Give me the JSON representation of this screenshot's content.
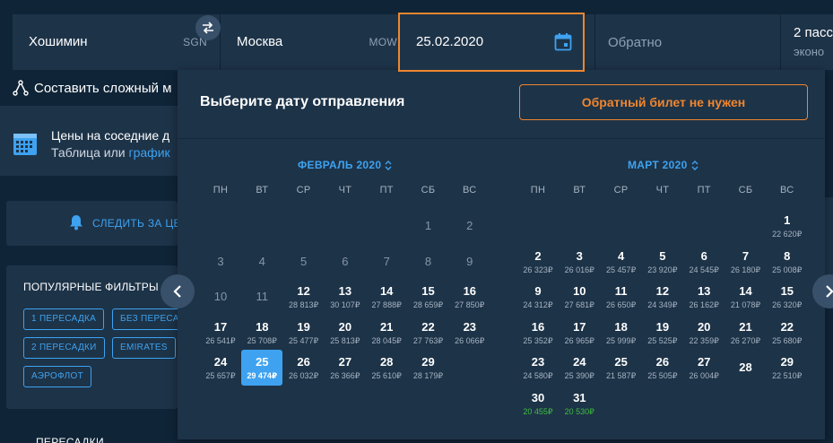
{
  "search": {
    "from_city": "Хошимин",
    "from_code": "SGN",
    "to_city": "Москва",
    "to_code": "MOW",
    "depart_date": "25.02.2020",
    "return_placeholder": "Обратно",
    "passengers": "2 пасс",
    "cabin": "эконо"
  },
  "left": {
    "complex_route": "Составить сложный м",
    "nearby_title": "Цены на соседние д",
    "nearby_table": "Таблица",
    "nearby_or": "или",
    "nearby_chart": "график",
    "follow_label": "СЛЕДИТЬ ЗА ЦЕ",
    "filters_title": "ПОПУЛЯРНЫЕ ФИЛЬТРЫ",
    "chips": [
      "1 ПЕРЕСАДКА",
      "БЕЗ ПЕРЕСАД",
      "2 ПЕРЕСАДКИ",
      "EMIRATES",
      "АЭРОФЛОТ"
    ],
    "transfers_title": "ПЕРЕСАДКИ"
  },
  "calendar": {
    "title": "Выберите дату отправления",
    "no_return_button": "Обратный билет не нужен",
    "weekdays": [
      "ПН",
      "ВТ",
      "СР",
      "ЧТ",
      "ПТ",
      "СБ",
      "ВС"
    ],
    "months": [
      {
        "name": "ФЕВРАЛЬ 2020",
        "days": [
          {
            "d": "1",
            "col": 5,
            "row": 0,
            "past": true
          },
          {
            "d": "2",
            "col": 6,
            "row": 0,
            "past": true
          },
          {
            "d": "3",
            "col": 0,
            "row": 1,
            "past": true
          },
          {
            "d": "4",
            "col": 1,
            "row": 1,
            "past": true
          },
          {
            "d": "5",
            "col": 2,
            "row": 1,
            "past": true
          },
          {
            "d": "6",
            "col": 3,
            "row": 1,
            "past": true
          },
          {
            "d": "7",
            "col": 4,
            "row": 1,
            "past": true
          },
          {
            "d": "8",
            "col": 5,
            "row": 1,
            "past": true
          },
          {
            "d": "9",
            "col": 6,
            "row": 1,
            "past": true
          },
          {
            "d": "10",
            "col": 0,
            "row": 2,
            "past": true
          },
          {
            "d": "11",
            "col": 1,
            "row": 2,
            "past": true
          },
          {
            "d": "12",
            "col": 2,
            "row": 2,
            "p": "28 813₽"
          },
          {
            "d": "13",
            "col": 3,
            "row": 2,
            "p": "30 107₽"
          },
          {
            "d": "14",
            "col": 4,
            "row": 2,
            "p": "27 888₽"
          },
          {
            "d": "15",
            "col": 5,
            "row": 2,
            "p": "28 659₽"
          },
          {
            "d": "16",
            "col": 6,
            "row": 2,
            "p": "27 850₽"
          },
          {
            "d": "17",
            "col": 0,
            "row": 3,
            "p": "26 541₽"
          },
          {
            "d": "18",
            "col": 1,
            "row": 3,
            "p": "25 708₽"
          },
          {
            "d": "19",
            "col": 2,
            "row": 3,
            "p": "25 477₽"
          },
          {
            "d": "20",
            "col": 3,
            "row": 3,
            "p": "25 813₽"
          },
          {
            "d": "21",
            "col": 4,
            "row": 3,
            "p": "28 045₽"
          },
          {
            "d": "22",
            "col": 5,
            "row": 3,
            "p": "27 763₽"
          },
          {
            "d": "23",
            "col": 6,
            "row": 3,
            "p": "26 066₽"
          },
          {
            "d": "24",
            "col": 0,
            "row": 4,
            "p": "25 657₽"
          },
          {
            "d": "25",
            "col": 1,
            "row": 4,
            "p": "29 474₽",
            "sel": true
          },
          {
            "d": "26",
            "col": 2,
            "row": 4,
            "p": "26 032₽"
          },
          {
            "d": "27",
            "col": 3,
            "row": 4,
            "p": "26 366₽"
          },
          {
            "d": "28",
            "col": 4,
            "row": 4,
            "p": "25 610₽"
          },
          {
            "d": "29",
            "col": 5,
            "row": 4,
            "p": "28 179₽"
          }
        ]
      },
      {
        "name": "МАРТ 2020",
        "days": [
          {
            "d": "1",
            "col": 6,
            "row": 0,
            "p": "22 620₽"
          },
          {
            "d": "2",
            "col": 0,
            "row": 1,
            "p": "26 323₽"
          },
          {
            "d": "3",
            "col": 1,
            "row": 1,
            "p": "26 016₽"
          },
          {
            "d": "4",
            "col": 2,
            "row": 1,
            "p": "25 457₽"
          },
          {
            "d": "5",
            "col": 3,
            "row": 1,
            "p": "23 920₽"
          },
          {
            "d": "6",
            "col": 4,
            "row": 1,
            "p": "24 545₽"
          },
          {
            "d": "7",
            "col": 5,
            "row": 1,
            "p": "26 180₽"
          },
          {
            "d": "8",
            "col": 6,
            "row": 1,
            "p": "25 008₽"
          },
          {
            "d": "9",
            "col": 0,
            "row": 2,
            "p": "24 312₽"
          },
          {
            "d": "10",
            "col": 1,
            "row": 2,
            "p": "27 681₽"
          },
          {
            "d": "11",
            "col": 2,
            "row": 2,
            "p": "26 650₽"
          },
          {
            "d": "12",
            "col": 3,
            "row": 2,
            "p": "24 349₽"
          },
          {
            "d": "13",
            "col": 4,
            "row": 2,
            "p": "26 162₽"
          },
          {
            "d": "14",
            "col": 5,
            "row": 2,
            "p": "21 078₽"
          },
          {
            "d": "15",
            "col": 6,
            "row": 2,
            "p": "26 320₽"
          },
          {
            "d": "16",
            "col": 0,
            "row": 3,
            "p": "25 352₽"
          },
          {
            "d": "17",
            "col": 1,
            "row": 3,
            "p": "26 965₽"
          },
          {
            "d": "18",
            "col": 2,
            "row": 3,
            "p": "25 999₽"
          },
          {
            "d": "19",
            "col": 3,
            "row": 3,
            "p": "25 525₽"
          },
          {
            "d": "20",
            "col": 4,
            "row": 3,
            "p": "22 359₽"
          },
          {
            "d": "21",
            "col": 5,
            "row": 3,
            "p": "26 270₽"
          },
          {
            "d": "22",
            "col": 6,
            "row": 3,
            "p": "25 680₽"
          },
          {
            "d": "23",
            "col": 0,
            "row": 4,
            "p": "24 580₽"
          },
          {
            "d": "24",
            "col": 1,
            "row": 4,
            "p": "25 390₽"
          },
          {
            "d": "25",
            "col": 2,
            "row": 4,
            "p": "21 587₽"
          },
          {
            "d": "26",
            "col": 3,
            "row": 4,
            "p": "25 505₽"
          },
          {
            "d": "27",
            "col": 4,
            "row": 4,
            "p": "26 004₽"
          },
          {
            "d": "28",
            "col": 5,
            "row": 4
          },
          {
            "d": "29",
            "col": 6,
            "row": 4,
            "p": "22 510₽"
          },
          {
            "d": "30",
            "col": 0,
            "row": 5,
            "p": "20 455₽",
            "green": true
          },
          {
            "d": "31",
            "col": 1,
            "row": 5,
            "p": "20 530₽",
            "green": true
          }
        ]
      }
    ]
  },
  "colors": {
    "accent": "#f0862e",
    "link": "#3ea2f0",
    "selected": "#3ea2f0",
    "cheap_price": "#3fbf3f",
    "panel": "#1d3348",
    "background": "#0f2437"
  }
}
